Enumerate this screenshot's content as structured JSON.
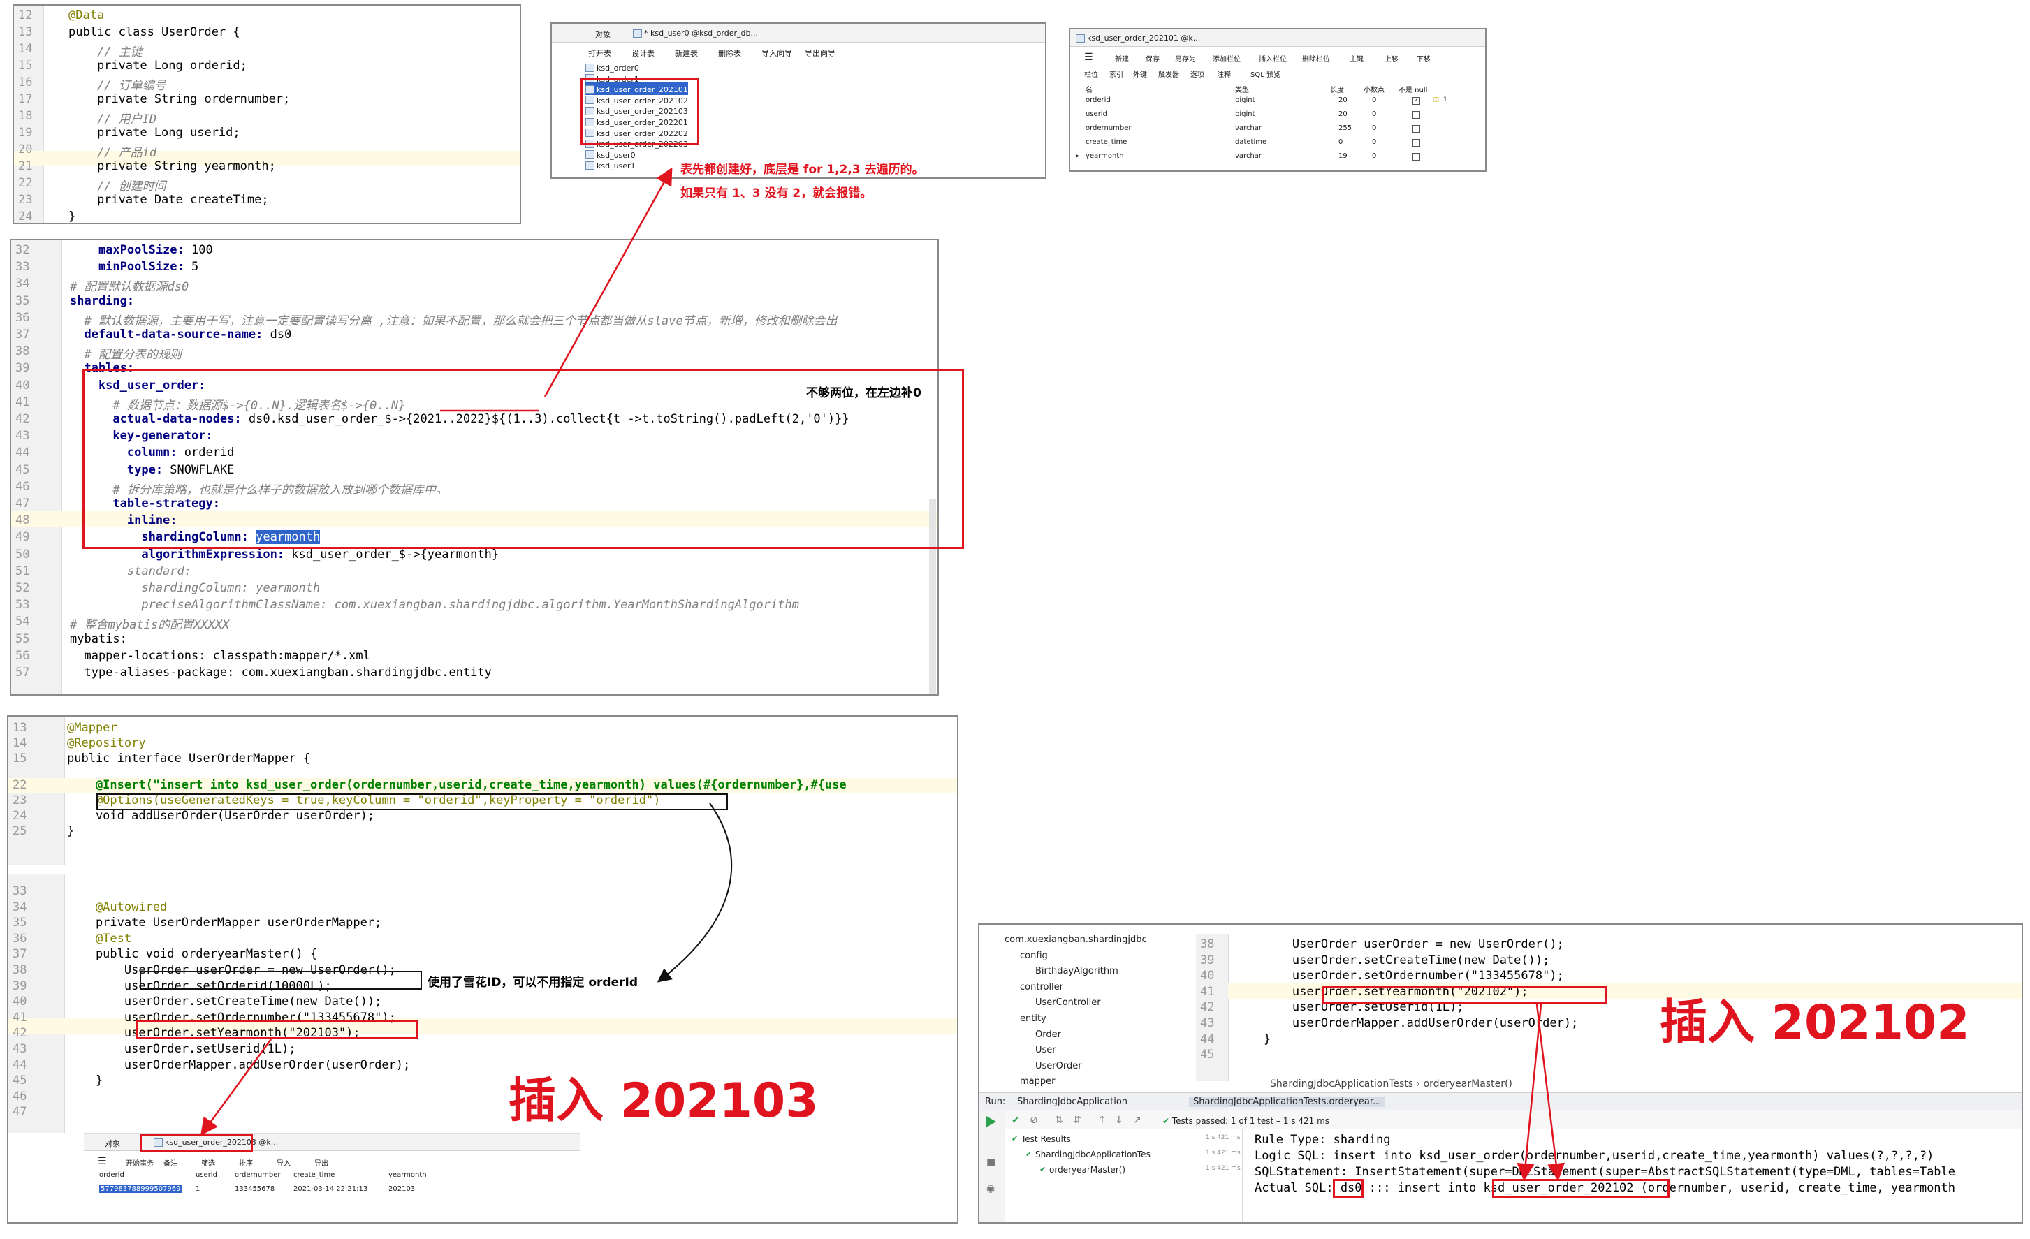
{
  "entity_panel": {
    "line_numbers": [
      "12",
      "13",
      "14",
      "15",
      "16",
      "17",
      "18",
      "19",
      "20",
      "21",
      "22",
      "23",
      "24"
    ],
    "lines": [
      "@Data",
      "public class UserOrder {",
      "    // 主键",
      "    private Long orderid;",
      "    // 订单编号",
      "    private String ordernumber;",
      "    // 用户ID",
      "    private Long userid;",
      "    // 产品id",
      "    private String yearmonth;",
      "    // 创建时间",
      "    private Date createTime;",
      "}"
    ]
  },
  "db_panel": {
    "toolbar": [
      "对象",
      "* ksd_user0 @ksd_order_db..."
    ],
    "actions": [
      "打开表",
      "设计表",
      "新建表",
      "删除表",
      "导入向导",
      "导出向导"
    ],
    "tables": [
      "ksd_order0",
      "ksd_order1",
      "ksd_user_order_202101",
      "ksd_user_order_202102",
      "ksd_user_order_202103",
      "ksd_user_order_202201",
      "ksd_user_order_202202",
      "ksd_user_order_202203",
      "ksd_user0",
      "ksd_user1"
    ],
    "note1": "表先都创建好，底层是 for 1,2,3 去遍历的。",
    "note2": "如果只有 1、3 没有 2，就会报错。"
  },
  "design_panel": {
    "title": "ksd_user_order_202101 @k...",
    "actions": [
      "新建",
      "保存",
      "另存为",
      "添加栏位",
      "插入栏位",
      "删除栏位",
      "主键",
      "上移",
      "下移"
    ],
    "tabs": [
      "栏位",
      "索引",
      "外键",
      "触发器",
      "选项",
      "注释",
      "SQL 预览"
    ],
    "headers": [
      "名",
      "类型",
      "长度",
      "小数点",
      "不是 null"
    ],
    "rows": [
      {
        "name": "orderid",
        "type": "bigint",
        "len": "20",
        "dec": "0",
        "notnull": true,
        "key": "1"
      },
      {
        "name": "userid",
        "type": "bigint",
        "len": "20",
        "dec": "0",
        "notnull": false,
        "key": ""
      },
      {
        "name": "ordernumber",
        "type": "varchar",
        "len": "255",
        "dec": "0",
        "notnull": false,
        "key": ""
      },
      {
        "name": "create_time",
        "type": "datetime",
        "len": "0",
        "dec": "0",
        "notnull": false,
        "key": ""
      },
      {
        "name": "yearmonth",
        "type": "varchar",
        "len": "19",
        "dec": "0",
        "notnull": false,
        "key": ""
      }
    ]
  },
  "yaml_panel": {
    "line_numbers": [
      "32",
      "33",
      "34",
      "35",
      "36",
      "37",
      "38",
      "39",
      "40",
      "41",
      "42",
      "43",
      "44",
      "45",
      "46",
      "47",
      "48",
      "49",
      "50",
      "51",
      "52",
      "53",
      "54",
      "55",
      "56",
      "57"
    ],
    "lines": [
      "    maxPoolSize: 100",
      "    minPoolSize: 5",
      "# 配置默认数据源ds0",
      "sharding:",
      "  # 默认数据源，主要用于写，注意一定要配置读写分离 ,注意：如果不配置，那么就会把三个节点都当做从slave节点，新增，修改和删除会出",
      "  default-data-source-name: ds0",
      "  # 配置分表的规则",
      "  tables:",
      "    ksd_user_order:",
      "      # 数据节点：数据源$->{0..N}.逻辑表名$->{0..N}",
      "      actual-data-nodes: ds0.ksd_user_order_$->{2021..2022}${(1..3).collect{t ->t.toString().padLeft(2,'0')}}",
      "      key-generator:",
      "        column: orderid",
      "        type: SNOWFLAKE",
      "      # 拆分库策略，也就是什么样子的数据放入放到哪个数据库中。",
      "      table-strategy:",
      "        inline:",
      "          shardingColumn: yearmonth",
      "          algorithmExpression: ksd_user_order_$->{yearmonth}",
      "        standard:",
      "          shardingColumn: yearmonth",
      "          preciseAlgorithmClassName: com.xuexiangban.shardingjdbc.algorithm.YearMonthShardingAlgorithm",
      "# 整合mybatis的配置XXXXX",
      "mybatis:",
      "  mapper-locations: classpath:mapper/*.xml",
      "  type-aliases-package: com.xuexiangban.shardingjdbc.entity"
    ],
    "note": "不够两位，在左边补0"
  },
  "mapper_panel": {
    "line_numbers": [
      "13",
      "14",
      "15",
      "",
      "22",
      "23",
      "24",
      "25"
    ],
    "lines": [
      "@Mapper",
      "@Repository",
      "public interface UserOrderMapper {",
      "",
      "    @Insert(\"insert into ksd_user_order(ordernumber,userid,create_time,yearmonth) values(#{ordernumber},#{use",
      "    @Options(useGeneratedKeys = true,keyColumn = \"orderid\",keyProperty = \"orderid\")",
      "    void addUserOrder(UserOrder userOrder);",
      "}"
    ],
    "test_line_numbers": [
      "33",
      "34",
      "35",
      "36",
      "37",
      "38",
      "39",
      "40",
      "41",
      "42",
      "43",
      "44",
      "45",
      "46",
      "47"
    ],
    "test_lines": [
      "",
      "    @Autowired",
      "    private UserOrderMapper userOrderMapper;",
      "    @Test",
      "    public void orderyearMaster() {",
      "        UserOrder userOrder = new UserOrder();",
      "        userOrder.setOrderid(10000L);",
      "        userOrder.setCreateTime(new Date());",
      "        userOrder.setOrdernumber(\"133455678\");",
      "        userOrder.setYearmonth(\"202103\");",
      "        userOrder.setUserid(1L);",
      "        userOrderMapper.addUserOrder(userOrder);",
      "    }",
      "",
      ""
    ],
    "note": "使用了雪花ID，可以不用指定 orderId",
    "big_label": "插入 202103",
    "result_tab": "ksd_user_order_202103 @k...",
    "result_obj": "对象",
    "result_actions": [
      "开始事务",
      "备注",
      "筛选",
      "排序",
      "导入",
      "导出"
    ],
    "result_headers": [
      "orderid",
      "userid",
      "ordernumber",
      "create_time",
      "yearmonth"
    ],
    "result_row": [
      "577983788999507969",
      "1",
      "133455678",
      "2021-03-14 22:21:13",
      "202103"
    ]
  },
  "run_panel": {
    "tree": [
      "com.xuexiangban.shardingjdbc",
      "config",
      "BirthdayAlgorithm",
      "controller",
      "UserController",
      "entity",
      "Order",
      "User",
      "UserOrder",
      "mapper"
    ],
    "line_numbers": [
      "38",
      "39",
      "40",
      "41",
      "42",
      "43",
      "44",
      "45"
    ],
    "lines": [
      "        UserOrder userOrder = new UserOrder();",
      "        userOrder.setCreateTime(new Date());",
      "        userOrder.setOrdernumber(\"133455678\");",
      "        userOrder.setYearmonth(\"202102\");",
      "        userOrder.setUserid(1L);",
      "        userOrderMapper.addUserOrder(userOrder);",
      "    }",
      ""
    ],
    "breadcrumb": "ShardingJdbcApplicationTests  ›  orderyearMaster()",
    "run_label": "Run:",
    "run_tabs": [
      "ShardingJdbcApplication",
      "ShardingJdbcApplicationTests.orderyear..."
    ],
    "tests_passed": "Tests passed: 1 of 1 test – 1 s 421 ms",
    "results_tree": [
      {
        "label": "Test Results",
        "time": "1 s 421 ms"
      },
      {
        "label": "ShardingJdbcApplicationTes",
        "time": "1 s 421 ms"
      },
      {
        "label": "orderyearMaster()",
        "time": "1 s 421 ms"
      }
    ],
    "console": [
      "Rule Type: sharding",
      "Logic SQL: insert into ksd_user_order(ordernumber,userid,create_time,yearmonth) values(?,?,?,?)",
      "SQLStatement: InsertStatement(super=DMLStatement(super=AbstractSQLStatement(type=DML, tables=Table",
      "Actual SQL: ds0 ::: insert into ksd_user_order_202102 (ordernumber, userid, create_time, yearmonth"
    ],
    "big_label": "插入 202102"
  },
  "colors": {
    "annotation_red": "#e0141e",
    "selection_blue": "#2f65ca"
  }
}
